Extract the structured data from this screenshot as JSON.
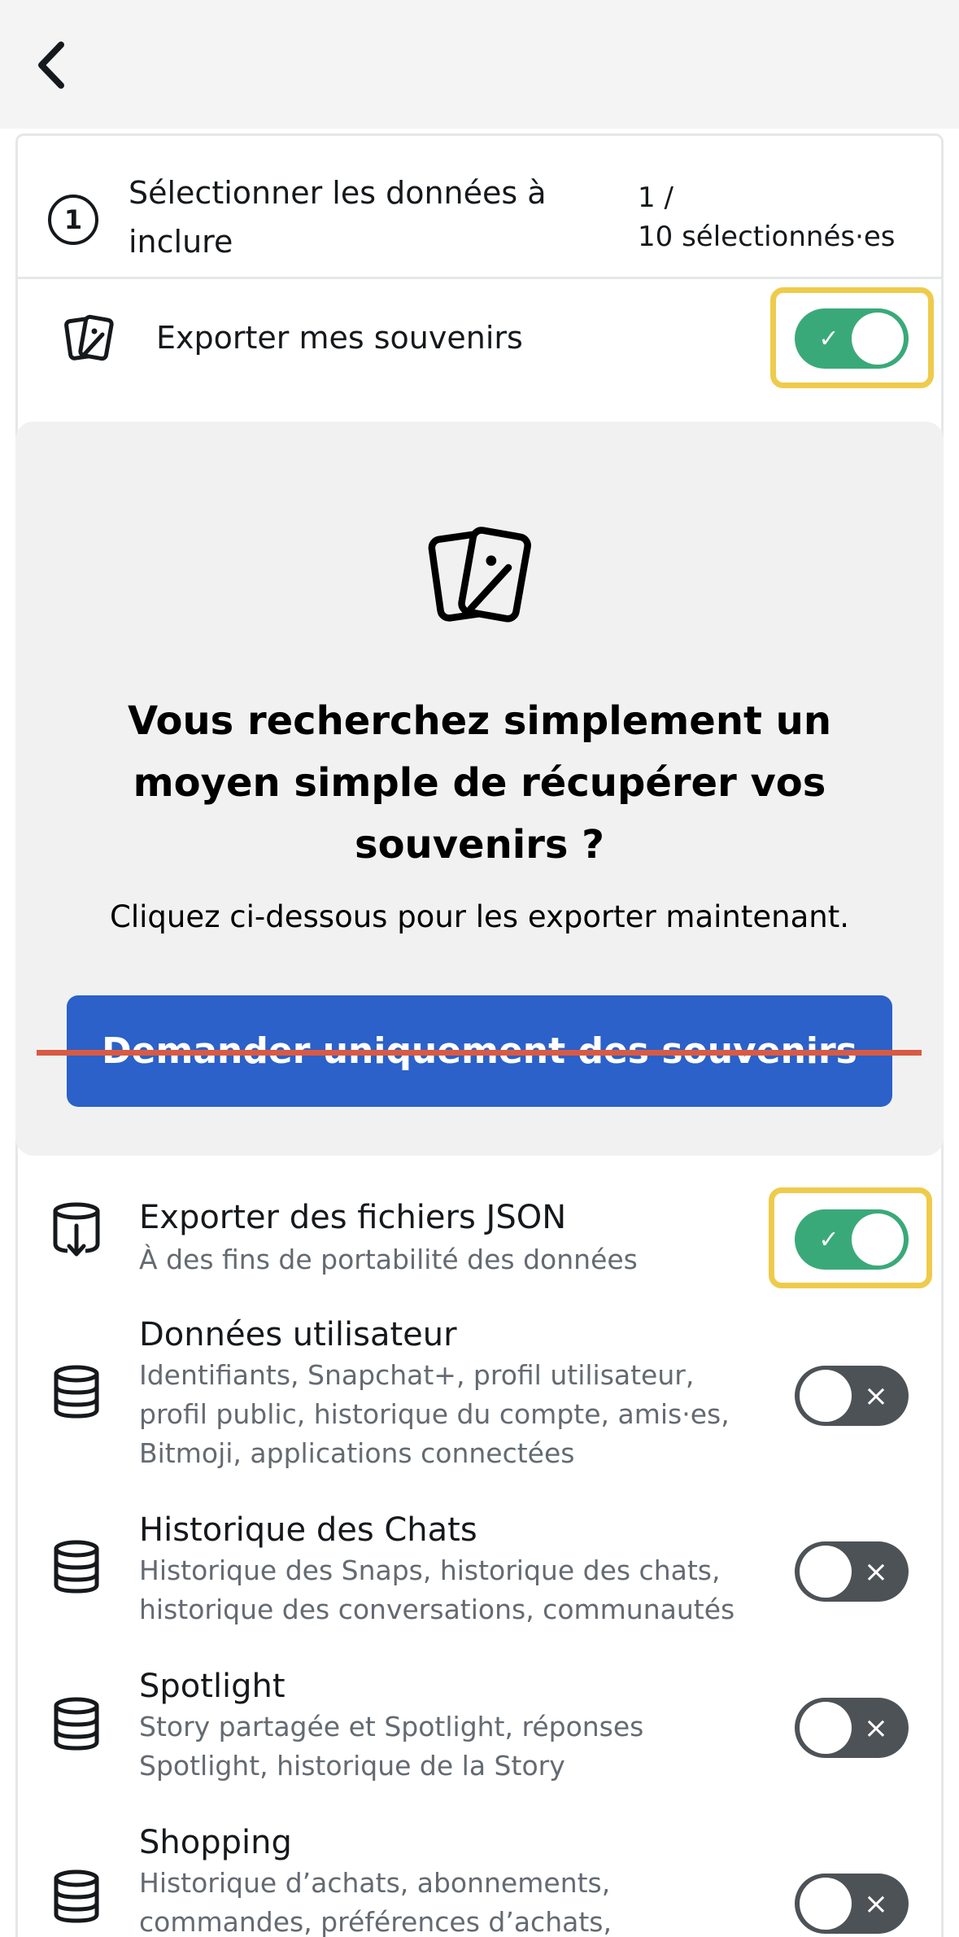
{
  "header": {
    "back_icon": "chevron-left-icon"
  },
  "step": {
    "number": "1",
    "title": "Sélectionner les données à inclure",
    "count_line1": "1 /",
    "count_line2": "10 sélectionnés·es"
  },
  "memories_row": {
    "icon": "photo-cards-icon",
    "label": "Exporter mes souvenirs",
    "toggle_on": true,
    "highlight_color": "#efcb4b"
  },
  "promo": {
    "icon": "photo-cards-icon",
    "title": "Vous recherchez simplement un moyen simple de récupérer vos souvenirs ?",
    "subtitle": "Cliquez ci-dessous pour les exporter maintenant.",
    "button_label": "Demander uniquement des souvenirs",
    "button_color": "#2b61c9",
    "strike_color": "#d95a43"
  },
  "options": [
    {
      "icon": "database-download-icon",
      "label": "Exporter des fichiers JSON",
      "description": "À des fins de portabilité des données",
      "toggle_on": true,
      "highlighted": true
    },
    {
      "icon": "database-icon",
      "label": "Données utilisateur",
      "description": "Identifiants, Snapchat+, profil utilisateur, profil public, historique du compte, amis·es, Bitmoji, applications connectées",
      "toggle_on": false
    },
    {
      "icon": "database-icon",
      "label": "Historique des Chats",
      "description": "Historique des Snaps, historique des chats, historique des conversations, communautés",
      "toggle_on": false
    },
    {
      "icon": "database-icon",
      "label": "Spotlight",
      "description": "Story partagée et Spotlight, réponses Spotlight, historique de la Story",
      "toggle_on": false
    },
    {
      "icon": "database-icon",
      "label": "Shopping",
      "description": "Historique d’achats, abonnements, commandes, préférences d’achats,",
      "toggle_on": false
    }
  ],
  "colors": {
    "toggle_on": "#3aa979",
    "toggle_off": "#4d5257"
  }
}
